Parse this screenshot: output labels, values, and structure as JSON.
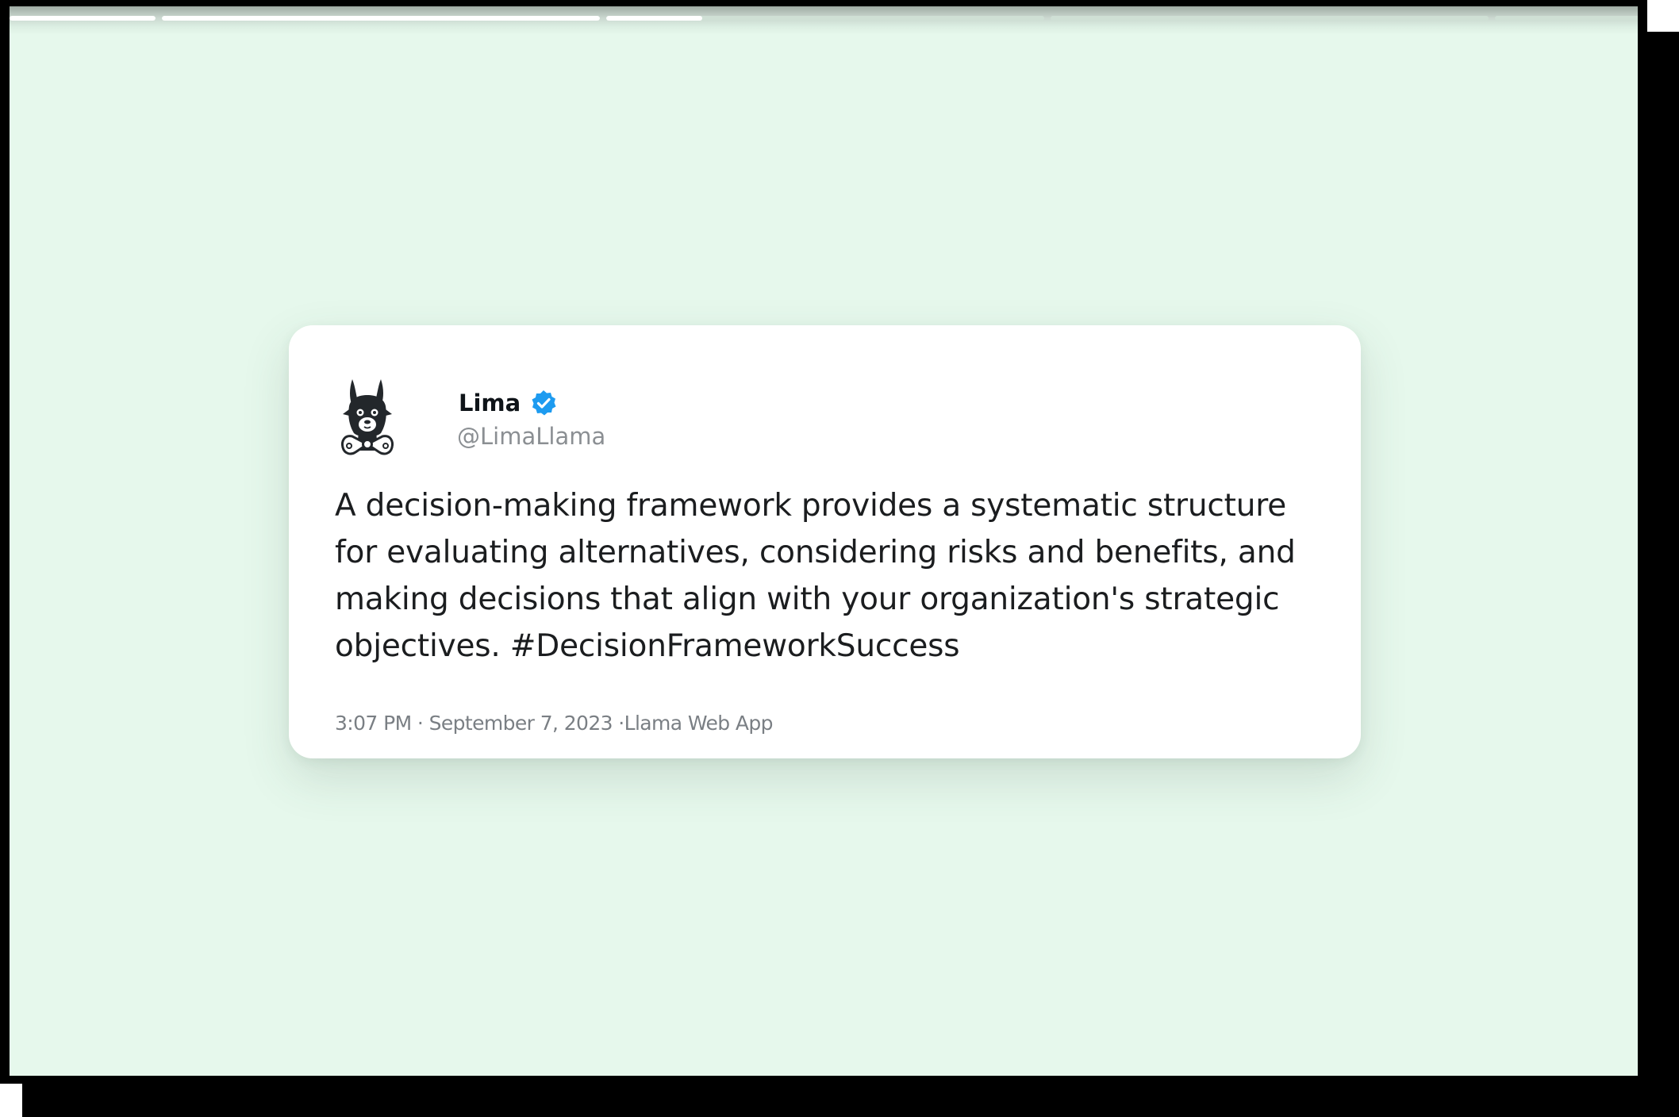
{
  "story_progress": {
    "track_color": "#cfe0d5",
    "fill_color": "#ffffff",
    "segments": [
      {
        "progress": 1.0
      },
      {
        "progress": 1.0
      },
      {
        "progress": 0.22
      },
      {
        "progress": 0.0
      },
      {
        "progress": 0.0
      },
      {
        "progress": 0.0
      }
    ]
  },
  "tweet": {
    "avatar_icon": "llama-avatar-icon",
    "author_name": "Lima",
    "verified_icon": "verified-badge-icon",
    "verified_color": "#1d9bf0",
    "handle": "@LimaLlama",
    "text": "A decision-making framework provides a systematic structure for evaluating alternatives, considering risks and benefits, and making decisions that align with your organization's strategic objectives. #DecisionFrameworkSuccess",
    "meta": "3:07 PM · September 7, 2023 ·Llama Web App"
  },
  "colors": {
    "background": "#e6f8ec",
    "card": "#ffffff",
    "frame": "#000000"
  }
}
